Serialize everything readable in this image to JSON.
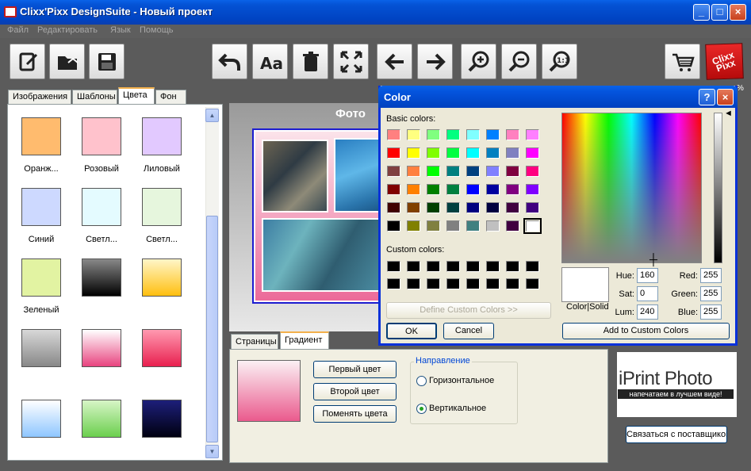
{
  "window": {
    "title": "Clixx'Pixx DesignSuite - Новый проект",
    "minimize": "_",
    "maximize": "□",
    "close": "×"
  },
  "menu": [
    "Файл",
    "Редактировать",
    "Язык",
    "Помощь"
  ],
  "toolbar": {
    "buttons": [
      "edit-project-icon",
      "open-folder-icon",
      "save-icon",
      "undo-icon",
      "text-font-icon",
      "trash-icon",
      "fullscreen-icon",
      "arrow-left-icon",
      "arrow-right-icon",
      "zoom-in-icon",
      "zoom-out-icon",
      "zoom-reset-icon",
      "shopping-cart-icon"
    ],
    "logo_text": "Clixx Pixx"
  },
  "left_tabs": [
    "Изображения",
    "Шаблоны",
    "Цвета",
    "Фон"
  ],
  "left_tabs_active": "Цвета",
  "colors": [
    {
      "label": "Оранж...",
      "color": "#ffbb6e"
    },
    {
      "label": "Розовый",
      "color": "#ffc2cc"
    },
    {
      "label": "Лиловый",
      "color": "#e2c9ff"
    },
    {
      "label": "Синий",
      "color": "#cdd9ff"
    },
    {
      "label": "Светл...",
      "color": "#e4fbff"
    },
    {
      "label": "Светл...",
      "color": "#e6f6dd"
    },
    {
      "label": "Зеленый",
      "color": "#e2f3a2"
    },
    {
      "label": "",
      "color": "gradient-black"
    },
    {
      "label": "",
      "color": "gradient-yellow"
    },
    {
      "label": "",
      "color": "gradient-gray"
    },
    {
      "label": "",
      "color": "gradient-pink"
    },
    {
      "label": "",
      "color": "gradient-red"
    },
    {
      "label": "",
      "color": "gradient-lightblue"
    },
    {
      "label": "",
      "color": "gradient-green"
    },
    {
      "label": "",
      "color": "gradient-navy"
    }
  ],
  "canvas": {
    "title": "Фото"
  },
  "bottom_tabs": [
    "Страницы",
    "Градиент"
  ],
  "bottom_tabs_active": "Градиент",
  "gradient": {
    "first_color": "Первый цвет",
    "second_color": "Второй цвет",
    "swap_colors": "Поменять цвета",
    "direction_label": "Направление",
    "horizontal": "Горизонтальное",
    "vertical": "Вертикальное",
    "selected": "vertical"
  },
  "ad": {
    "main": "iPrint Photo",
    "sub": "напечатаем в лучшем виде!"
  },
  "contact_button": "Связаться с поставщиком",
  "percent_text": "%",
  "color_dialog": {
    "title": "Color",
    "help": "?",
    "close": "×",
    "basic_colors_label": "Basic colors:",
    "basic_colors": [
      "#ff8080",
      "#ffff80",
      "#80ff80",
      "#00ff80",
      "#80ffff",
      "#0080ff",
      "#ff80c0",
      "#ff80ff",
      "#ff0000",
      "#ffff00",
      "#80ff00",
      "#00ff40",
      "#00ffff",
      "#0080c0",
      "#8080c0",
      "#ff00ff",
      "#804040",
      "#ff8040",
      "#00ff00",
      "#008080",
      "#004080",
      "#8080ff",
      "#800040",
      "#ff0080",
      "#800000",
      "#ff8000",
      "#008000",
      "#008040",
      "#0000ff",
      "#0000a0",
      "#800080",
      "#8000ff",
      "#400000",
      "#804000",
      "#004000",
      "#004040",
      "#000080",
      "#000040",
      "#400040",
      "#400080",
      "#000000",
      "#808000",
      "#808040",
      "#808080",
      "#408080",
      "#c0c0c0",
      "#400040",
      "#ffffff"
    ],
    "custom_colors_label": "Custom colors:",
    "define_custom": "Define Custom Colors >>",
    "ok": "OK",
    "cancel": "Cancel",
    "color_solid": "Color|Solid",
    "hue_label": "Hue:",
    "hue": "160",
    "sat_label": "Sat:",
    "sat": "0",
    "lum_label": "Lum:",
    "lum": "240",
    "red_label": "Red:",
    "red": "255",
    "green_label": "Green:",
    "green": "255",
    "blue_label": "Blue:",
    "blue": "255",
    "add_custom": "Add to Custom Colors"
  }
}
